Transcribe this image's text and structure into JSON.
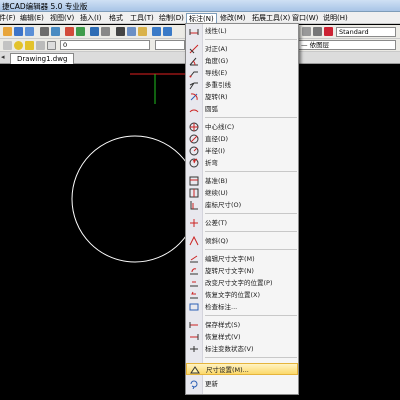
{
  "window": {
    "title": "捷CAD编辑器 5.0 专业版"
  },
  "menubar": {
    "items": [
      "件(F)",
      "编辑(E)",
      "视图(V)",
      "插入(I)",
      "格式",
      "工具(T)",
      "绘制(D)",
      "标注(N)",
      "修改(M)",
      "拓展工具(X)",
      "窗口(W)",
      "说明(H)"
    ]
  },
  "toolbar2": {
    "layer_value": "0",
    "linetype_label": "— 依图层",
    "font_value": "Standard"
  },
  "tabs": {
    "active": "Drawing1.dwg"
  },
  "dim_menu": {
    "items": [
      {
        "label": "线性(L)",
        "icon": "linear-dim-icon"
      },
      {
        "label": "对正(A)",
        "icon": "aligned-dim-icon"
      },
      {
        "label": "角度(G)",
        "icon": "angular-dim-icon"
      },
      {
        "label": "导线(E)",
        "icon": "leader-icon"
      },
      {
        "label": "多重引线",
        "icon": "multileader-icon"
      },
      {
        "label": "旋转(R)",
        "icon": "rotated-dim-icon"
      },
      {
        "label": "圆弧",
        "icon": "arc-dim-icon"
      },
      {
        "label": "中心线(C)",
        "icon": "centerline-icon"
      },
      {
        "label": "直径(D)",
        "icon": "diameter-icon"
      },
      {
        "label": "半径(I)",
        "icon": "radius-icon"
      },
      {
        "label": "折弯",
        "icon": "jogged-icon"
      },
      {
        "label": "基准(B)",
        "icon": "baseline-icon"
      },
      {
        "label": "继续(U)",
        "icon": "continue-icon"
      },
      {
        "label": "座标尺寸(O)",
        "icon": "ordinate-icon"
      },
      {
        "label": "公差(T)",
        "icon": "tolerance-icon"
      },
      {
        "label": "倾斜(Q)",
        "icon": "oblique-icon"
      },
      {
        "label": "编辑尺寸文字(M)",
        "icon": "edit-dim-text-icon"
      },
      {
        "label": "旋转尺寸文字(N)",
        "icon": "rotate-dim-text-icon"
      },
      {
        "label": "改变尺寸文字的位置(P)",
        "icon": "move-dim-text-icon"
      },
      {
        "label": "恢复文字的位置(X)",
        "icon": "restore-text-icon"
      },
      {
        "label": "检查标注...",
        "icon": "inspect-dim-icon"
      },
      {
        "label": "保存样式(S)",
        "icon": "save-style-icon"
      },
      {
        "label": "恢复样式(V)",
        "icon": "restore-style-icon"
      },
      {
        "label": "标注变数状态(V)",
        "icon": "dim-status-icon"
      },
      {
        "label": "尺寸设置(M)...",
        "icon": "dim-settings-icon"
      },
      {
        "label": "更新",
        "icon": "update-icon"
      }
    ]
  },
  "colors": {
    "menu_highlight": "#fbd86a",
    "canvas": "#000000",
    "circle": "#ffffff"
  }
}
